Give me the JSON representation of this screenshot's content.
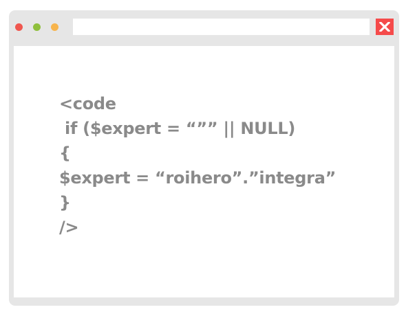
{
  "window": {
    "colors": {
      "frame": "#e6e6e6",
      "dot_red": "#f0574f",
      "dot_green": "#8fbf3c",
      "dot_yellow": "#f7b44c",
      "close_bg": "#f54b4b",
      "code_text": "#8a8a8a"
    },
    "address_bar": {
      "value": ""
    },
    "close_icon": "close-x-icon"
  },
  "code": {
    "lines": [
      "<code",
      " if ($expert = “”” || NULL)",
      "{",
      "$expert = “roihero”.”integra”",
      "}",
      "/>"
    ]
  }
}
